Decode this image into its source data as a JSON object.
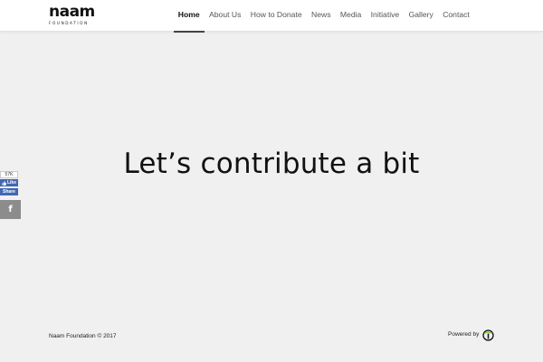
{
  "header": {
    "logo": {
      "mark": "naam",
      "sub": "FOUNDATION"
    },
    "nav": [
      {
        "label": "Home",
        "active": true
      },
      {
        "label": "About Us"
      },
      {
        "label": "How to Donate"
      },
      {
        "label": "News"
      },
      {
        "label": "Media"
      },
      {
        "label": "Initiative"
      },
      {
        "label": "Gallery"
      },
      {
        "label": "Contact"
      }
    ]
  },
  "hero": {
    "title": "Let’s contribute a bit"
  },
  "social": {
    "count": "57K",
    "like_label": "Like",
    "share_label": "Share",
    "facebook_glyph": "f"
  },
  "footer": {
    "copyright": "Naam Foundation © 2017",
    "powered_by": "Powered by"
  },
  "colors": {
    "background": "#f0f0f0",
    "header_bg": "#ffffff",
    "facebook_blue": "#4267b2",
    "share_square": "#8c8c8c"
  }
}
